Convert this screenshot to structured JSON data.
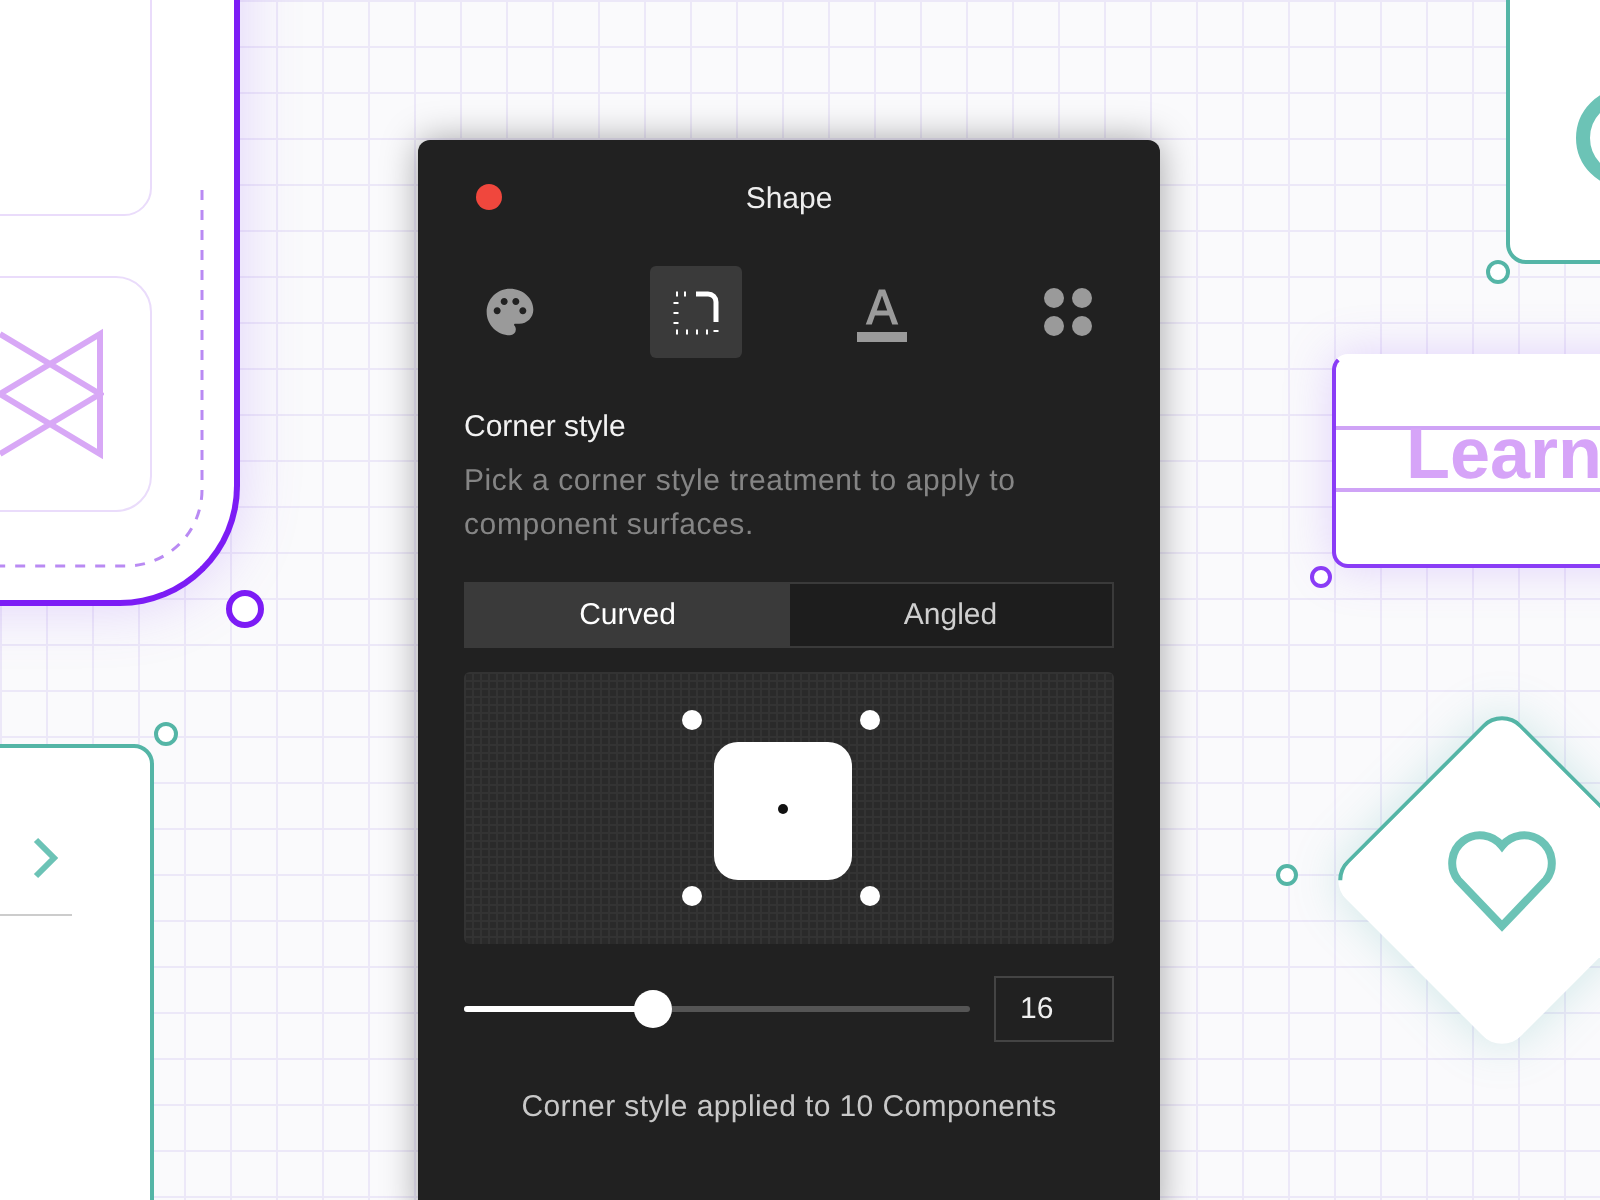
{
  "canvas": {
    "label_card_text": "Learn"
  },
  "panel": {
    "title": "Shape"
  },
  "tabs": [
    {
      "kind": "palette",
      "selected": false
    },
    {
      "kind": "corner",
      "selected": true
    },
    {
      "kind": "text",
      "selected": false
    },
    {
      "kind": "grid",
      "selected": false
    }
  ],
  "section": {
    "title": "Corner style",
    "description": "Pick a corner style treatment to apply to component surfaces."
  },
  "segments": [
    {
      "label": "Curved",
      "selected": true
    },
    {
      "label": "Angled",
      "selected": false
    }
  ],
  "slider": {
    "level": 0.37,
    "value": "16"
  },
  "footer": "Corner style applied to 10 Components"
}
